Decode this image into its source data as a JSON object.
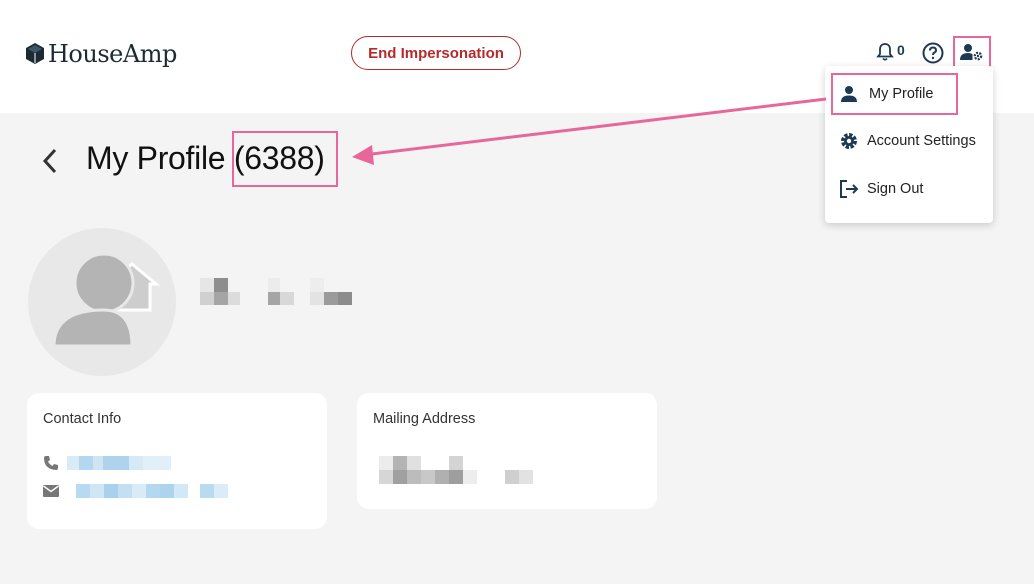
{
  "header": {
    "logo_text": "HouseAmp",
    "end_impersonation_label": "End Impersonation",
    "notification_count": "0"
  },
  "menu": {
    "items": [
      {
        "label": "My Profile",
        "icon": "person-icon"
      },
      {
        "label": "Account Settings",
        "icon": "gear-icon"
      },
      {
        "label": "Sign Out",
        "icon": "sign-out-icon"
      }
    ]
  },
  "page": {
    "title_prefix": "My Profile",
    "title_id": "(6388)"
  },
  "cards": {
    "contact_title": "Contact Info",
    "mailing_title": "Mailing Address"
  },
  "colors": {
    "accent_red": "#b52a2a",
    "annotation_pink": "#e8679a",
    "brand_navy": "#1c3a55"
  }
}
